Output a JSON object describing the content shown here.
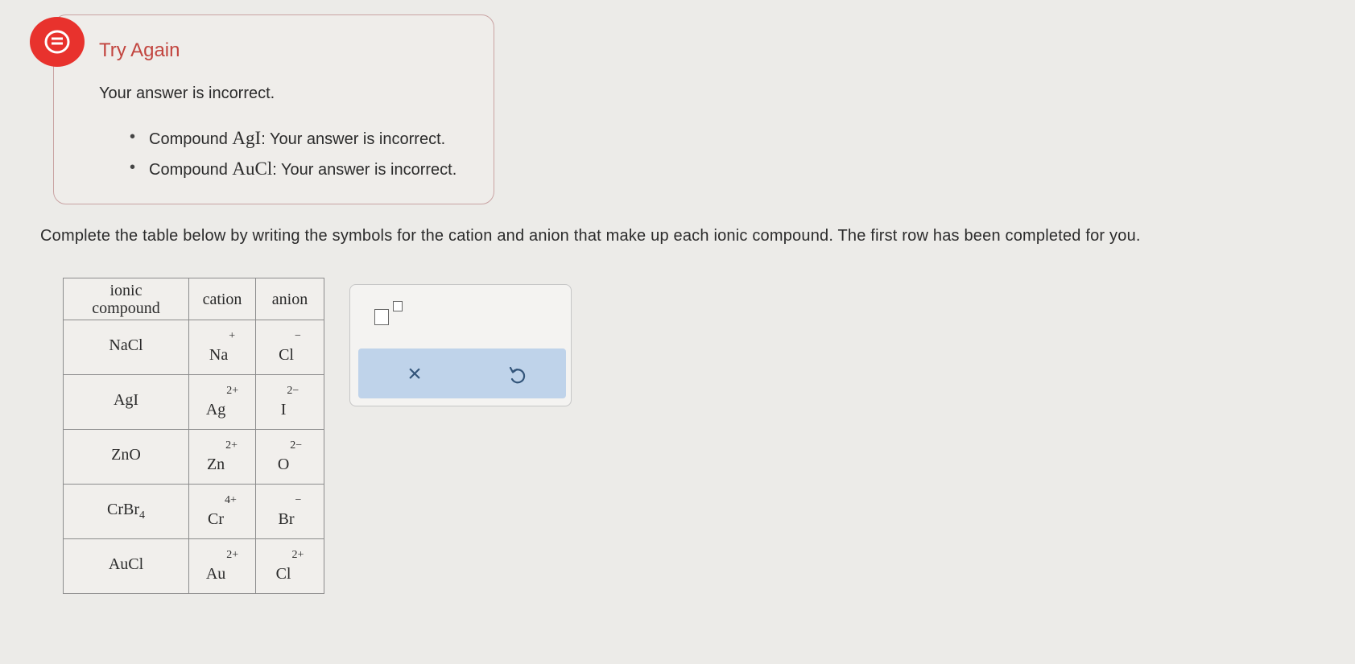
{
  "feedback": {
    "icon": "message-icon",
    "title": "Try Again",
    "message": "Your answer is incorrect.",
    "items": [
      {
        "prefix": "Compound ",
        "compound": "AgI",
        "suffix": ": Your answer is incorrect."
      },
      {
        "prefix": "Compound ",
        "compound": "AuCl",
        "suffix": ": Your answer is incorrect."
      }
    ]
  },
  "instructions": "Complete the table below by writing the symbols for the cation and anion that make up each ionic compound. The first row has been completed for you.",
  "table": {
    "headers": {
      "compound_line1": "ionic",
      "compound_line2": "compound",
      "cation": "cation",
      "anion": "anion"
    },
    "rows": [
      {
        "compound": "NaCl",
        "compound_sub": "",
        "cation": "Na",
        "cation_charge": "+",
        "anion": "Cl",
        "anion_charge": "−"
      },
      {
        "compound": "AgI",
        "compound_sub": "",
        "cation": "Ag",
        "cation_charge": "2+",
        "anion": "I",
        "anion_charge": "2−"
      },
      {
        "compound": "ZnO",
        "compound_sub": "",
        "cation": "Zn",
        "cation_charge": "2+",
        "anion": "O",
        "anion_charge": "2−"
      },
      {
        "compound": "CrBr",
        "compound_sub": "4",
        "cation": "Cr",
        "cation_charge": "4+",
        "anion": "Br",
        "anion_charge": "−"
      },
      {
        "compound": "AuCl",
        "compound_sub": "",
        "cation": "Au",
        "cation_charge": "2+",
        "anion": "Cl",
        "anion_charge": "2+"
      }
    ]
  },
  "toolbox": {
    "superscript_icon": "superscript-icon",
    "clear_label": "×",
    "clear_icon": "close-icon",
    "undo_icon": "undo-icon"
  },
  "colors": {
    "error_red": "#e8322d",
    "title_red": "#c2453f",
    "action_bar_blue": "#bfd3ea"
  }
}
